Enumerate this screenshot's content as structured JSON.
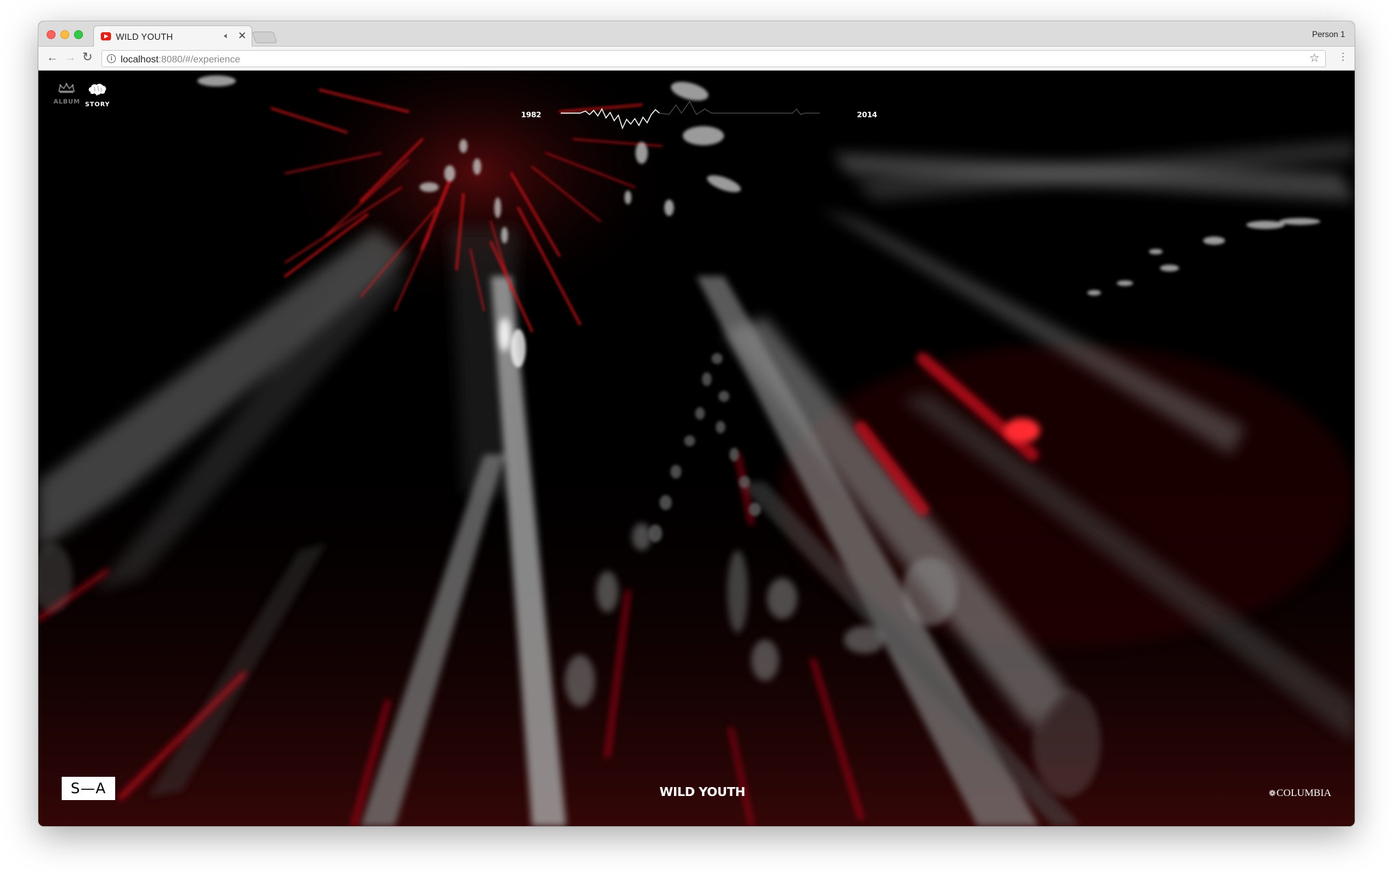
{
  "browser": {
    "tab_title": "WILD YOUTH",
    "profile": "Person 1",
    "url_host": "localhost",
    "url_rest": ":8080/#/experience"
  },
  "site": {
    "nav": {
      "album_label": "ALBUM",
      "story_label": "STORY",
      "active": "story"
    },
    "timeline": {
      "start_year": "1982",
      "end_year": "2014"
    },
    "brand_logo": "S—A",
    "title": "WILD YOUTH",
    "label_logo": "COLUMBIA"
  },
  "colors": {
    "background": "#000000",
    "accent_red": "#e3141b",
    "stream_gray": "#9a9a9a",
    "text": "#ffffff"
  }
}
